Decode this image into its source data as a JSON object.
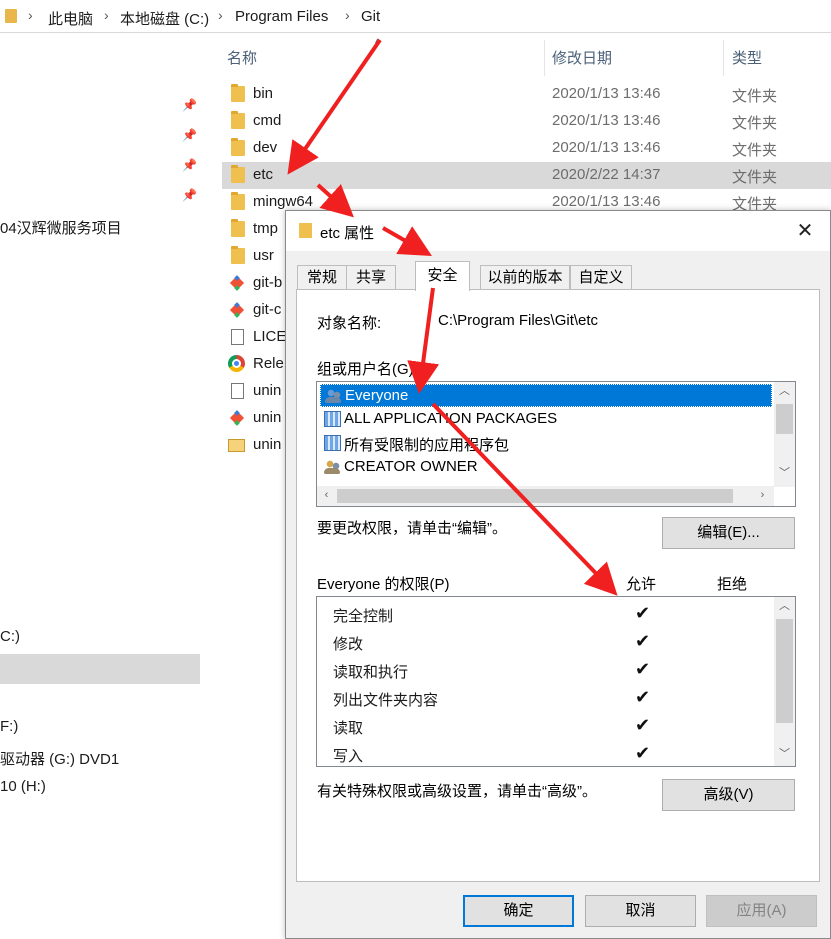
{
  "address_bar": {
    "crumbs": [
      "此电脑",
      "本地磁盘 (C:)",
      "Program Files",
      "Git"
    ],
    "separator": "›"
  },
  "nav_pane": {
    "items": [
      {
        "label": "04汉辉微服务项目"
      },
      {
        "label": "C:)"
      },
      {
        "label": "F:)"
      },
      {
        "label": "驱动器 (G:) DVD1"
      },
      {
        "label": "10 (H:)"
      }
    ]
  },
  "columns": {
    "name": "名称",
    "date": "修改日期",
    "type": "类型"
  },
  "files": [
    {
      "name": "bin",
      "date": "2020/1/13 13:46",
      "type": "文件夹",
      "icon": "folder-icon"
    },
    {
      "name": "cmd",
      "date": "2020/1/13 13:46",
      "type": "文件夹",
      "icon": "folder-icon"
    },
    {
      "name": "dev",
      "date": "2020/1/13 13:46",
      "type": "文件夹",
      "icon": "folder-icon"
    },
    {
      "name": "etc",
      "date": "2020/2/22 14:37",
      "type": "文件夹",
      "icon": "folder-icon"
    },
    {
      "name": "mingw64",
      "date": "2020/1/13 13:46",
      "type": "文件夹",
      "icon": "folder-icon"
    },
    {
      "name": "tmp",
      "icon": "folder-icon"
    },
    {
      "name": "usr",
      "icon": "folder-icon"
    },
    {
      "name": "git-b",
      "icon": "git-icon"
    },
    {
      "name": "git-c",
      "icon": "git-icon"
    },
    {
      "name": "LICE",
      "icon": "document-icon"
    },
    {
      "name": "Rele",
      "icon": "chrome-icon"
    },
    {
      "name": "unin",
      "icon": "document-icon"
    },
    {
      "name": "unin",
      "icon": "git-icon"
    },
    {
      "name": "unin",
      "icon": "mail-icon"
    }
  ],
  "dialog": {
    "title": "etc 属性",
    "close": "✕",
    "tabs": [
      "常规",
      "共享",
      "安全",
      "以前的版本",
      "自定义"
    ],
    "active_tab": "安全",
    "object_label": "对象名称:",
    "object_value": "C:\\Program Files\\Git\\etc",
    "groups_label": "组或用户名(G):",
    "groups": [
      {
        "name": "Everyone",
        "icon": "users-icon",
        "selected": true
      },
      {
        "name": "ALL APPLICATION PACKAGES",
        "icon": "package-icon"
      },
      {
        "name": "所有受限制的应用程序包",
        "icon": "package-icon"
      },
      {
        "name": "CREATOR OWNER",
        "icon": "owner-icon"
      }
    ],
    "edit_hint": "要更改权限，请单击“编辑”。",
    "edit_button": "编辑(E)...",
    "perms_label": "Everyone 的权限(P)",
    "allow_header": "允许",
    "deny_header": "拒绝",
    "permissions": [
      {
        "name": "完全控制",
        "allow": "✔",
        "deny": ""
      },
      {
        "name": "修改",
        "allow": "✔",
        "deny": ""
      },
      {
        "name": "读取和执行",
        "allow": "✔",
        "deny": ""
      },
      {
        "name": "列出文件夹内容",
        "allow": "✔",
        "deny": ""
      },
      {
        "name": "读取",
        "allow": "✔",
        "deny": ""
      },
      {
        "name": "写入",
        "allow": "✔",
        "deny": ""
      }
    ],
    "advanced_hint": "有关特殊权限或高级设置，请单击“高级”。",
    "advanced_button": "高级(V)",
    "ok_button": "确定",
    "cancel_button": "取消",
    "apply_button": "应用(A)"
  },
  "annotations": {
    "arrow_color": "#f02020"
  }
}
